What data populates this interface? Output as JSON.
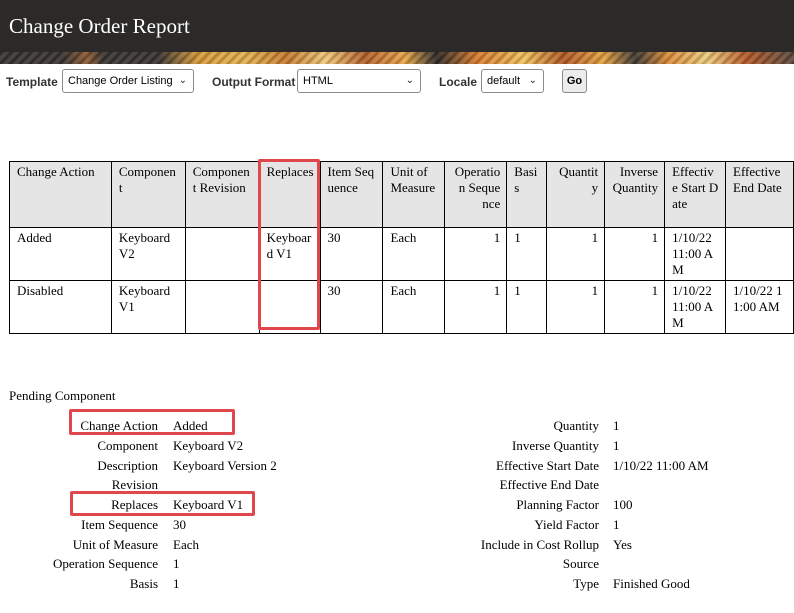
{
  "title": "Change Order Report",
  "toolbar": {
    "template_label": "Template",
    "template_value": "Change Order Listing",
    "output_label": "Output Format",
    "output_value": "HTML",
    "locale_label": "Locale",
    "locale_value": "default",
    "go_label": "Go"
  },
  "table": {
    "headers": [
      "Change Action",
      "Component",
      "Component Revision",
      "Replaces",
      "Item Sequence",
      "Unit of Measure",
      "Operation Sequence",
      "Basis",
      "Quantity",
      "Inverse Quantity",
      "Effective Start Date",
      "Effective End Date"
    ],
    "rows": [
      [
        "Added",
        "Keyboard V2",
        "",
        "Keyboard V1",
        "30",
        "Each",
        "1",
        "1",
        "1",
        "1",
        "1/10/22 11:00 AM",
        ""
      ],
      [
        "Disabled",
        "Keyboard V1",
        "",
        "",
        "30",
        "Each",
        "1",
        "1",
        "1",
        "1",
        "1/10/22 11:00 AM",
        "1/10/22 11:00 AM"
      ]
    ]
  },
  "pending": {
    "title": "Pending Component",
    "left": [
      {
        "key": "Change Action",
        "value": "Added"
      },
      {
        "key": "Component",
        "value": "Keyboard V2"
      },
      {
        "key": "Description",
        "value": "Keyboard Version 2"
      },
      {
        "key": "Revision",
        "value": ""
      },
      {
        "key": "Replaces",
        "value": "Keyboard V1"
      },
      {
        "key": "Item Sequence",
        "value": "30"
      },
      {
        "key": "Unit of Measure",
        "value": "Each"
      },
      {
        "key": "Operation Sequence",
        "value": "1"
      },
      {
        "key": "Basis",
        "value": "1"
      }
    ],
    "right": [
      {
        "key": "Quantity",
        "value": "1"
      },
      {
        "key": "Inverse Quantity",
        "value": "1"
      },
      {
        "key": "Effective Start Date",
        "value": "1/10/22 11:00 AM"
      },
      {
        "key": "Effective End Date",
        "value": ""
      },
      {
        "key": "Planning Factor",
        "value": "100"
      },
      {
        "key": "Yield Factor",
        "value": "1"
      },
      {
        "key": "Include in Cost Rollup",
        "value": "Yes"
      },
      {
        "key": "Source",
        "value": ""
      },
      {
        "key": "Type",
        "value": "Finished Good"
      }
    ]
  },
  "colors": {
    "titlebar": "#2b2a28",
    "header_cell": "#e5e5e5",
    "highlight": "#e0474c"
  },
  "icons": {
    "dropdown": "chevron-down-icon"
  }
}
